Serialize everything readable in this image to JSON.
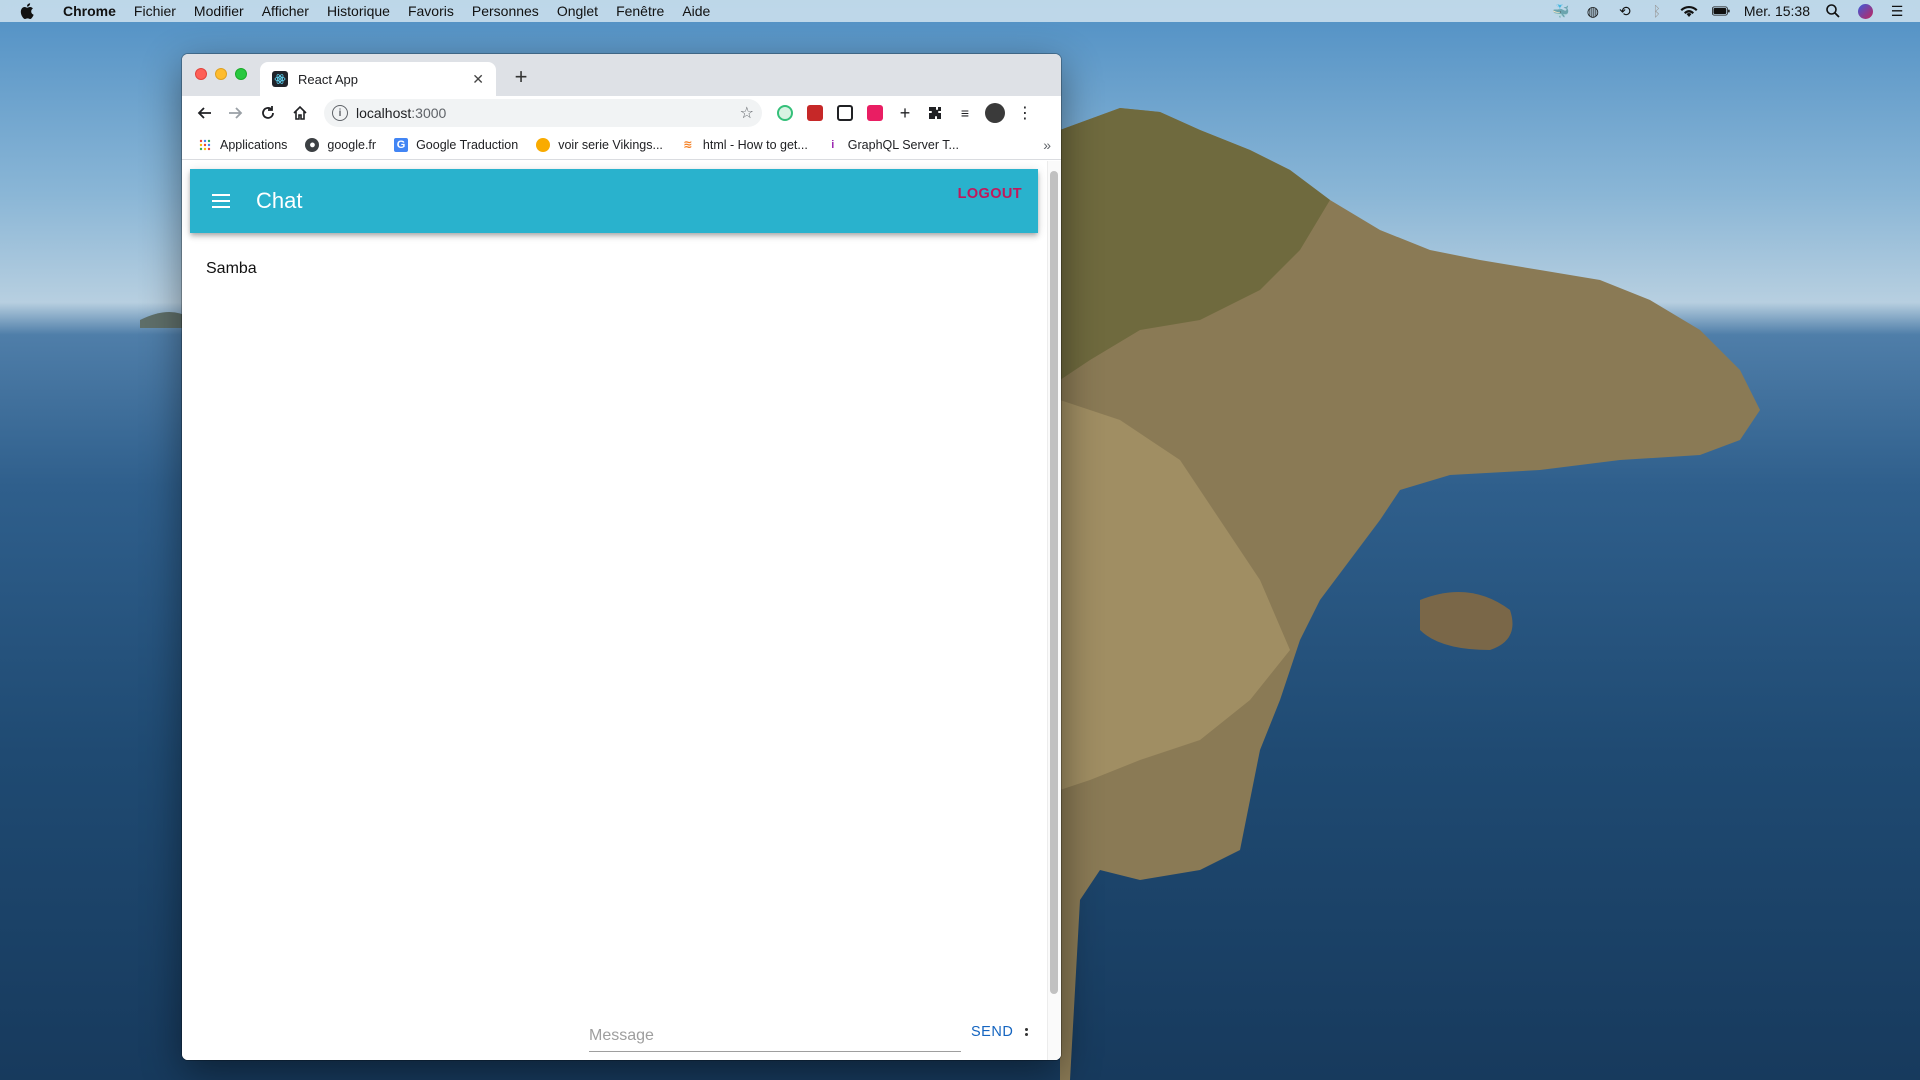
{
  "menubar": {
    "app_name": "Chrome",
    "items": [
      "Fichier",
      "Modifier",
      "Afficher",
      "Historique",
      "Favoris",
      "Personnes",
      "Onglet",
      "Fenêtre",
      "Aide"
    ],
    "clock": "Mer. 15:38"
  },
  "browser": {
    "tab_title": "React App",
    "url_host": "localhost",
    "url_port": ":3000",
    "bookmarks": [
      {
        "label": "Applications",
        "icon": "apps-grid-icon"
      },
      {
        "label": "google.fr",
        "icon": "globe-icon"
      },
      {
        "label": "Google Traduction",
        "icon": "translate-icon"
      },
      {
        "label": "voir serie Vikings...",
        "icon": "sun-icon"
      },
      {
        "label": "html - How to get...",
        "icon": "stackoverflow-icon"
      },
      {
        "label": "GraphQL Server T...",
        "icon": "info-icon"
      }
    ],
    "bookmarks_more": "»"
  },
  "app": {
    "title": "Chat",
    "logout_label": "LOGOUT",
    "channel_name": "Samba",
    "message_placeholder": "Message",
    "send_label": "SEND"
  },
  "colors": {
    "appbar": "#29b2cd",
    "logout": "#c2185b",
    "send": "#1565c0"
  }
}
